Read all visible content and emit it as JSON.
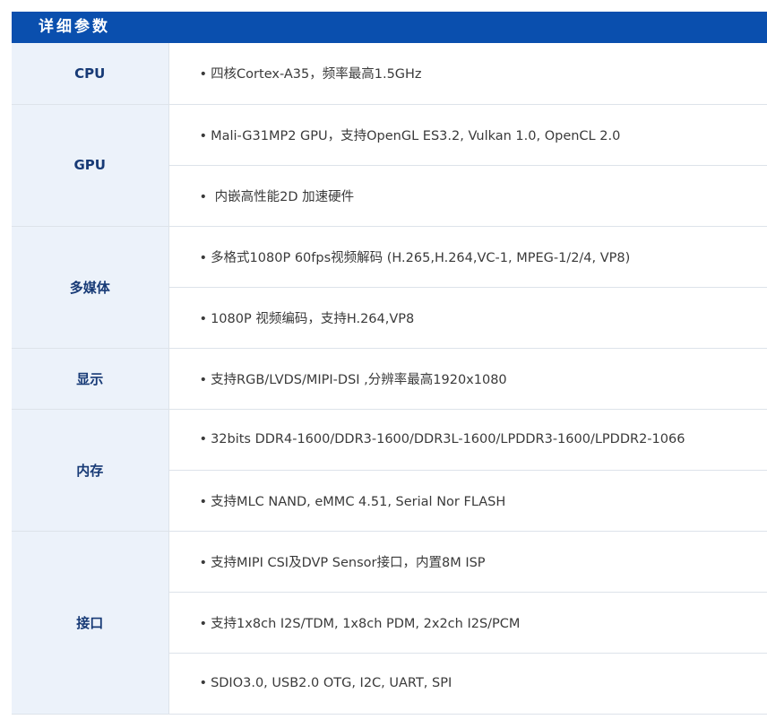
{
  "header": {
    "title": "详细参数"
  },
  "specs": [
    {
      "category": "CPU",
      "items": [
        "四核Cortex-A35，频率最高1.5GHz"
      ]
    },
    {
      "category": "GPU",
      "items": [
        "Mali-G31MP2 GPU，支持OpenGL ES3.2, Vulkan 1.0, OpenCL 2.0",
        " 内嵌高性能2D 加速硬件"
      ]
    },
    {
      "category": "多媒体",
      "items": [
        "多格式1080P 60fps视频解码 (H.265,H.264,VC-1, MPEG-1/2/4, VP8)",
        "1080P 视频编码，支持H.264,VP8"
      ]
    },
    {
      "category": "显示",
      "items": [
        "支持RGB/LVDS/MIPI-DSI ,分辨率最高1920x1080"
      ]
    },
    {
      "category": "内存",
      "items": [
        "32bits DDR4-1600/DDR3-1600/DDR3L-1600/LPDDR3-1600/LPDDR2-1066",
        "支持MLC NAND, eMMC 4.51, Serial Nor FLASH"
      ]
    },
    {
      "category": "接口",
      "items": [
        "支持MIPI CSI及DVP Sensor接口，内置8M ISP",
        "支持1x8ch I2S/TDM, 1x8ch PDM, 2x2ch I2S/PCM",
        "SDIO3.0, USB2.0 OTG, I2C, UART, SPI"
      ]
    }
  ],
  "bullet_char": "•",
  "colors": {
    "header_bg": "#0a4fae",
    "category_bg": "#ecf2fa",
    "category_text": "#173a76",
    "border": "#dde3ea"
  }
}
